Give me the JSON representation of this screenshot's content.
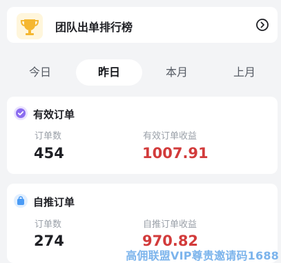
{
  "banner": {
    "title": "团队出单排行榜",
    "icon": "trophy-icon",
    "action_icon": "chevron-right-icon"
  },
  "tabs": [
    {
      "label": "今日",
      "active": false
    },
    {
      "label": "昨日",
      "active": true
    },
    {
      "label": "本月",
      "active": false
    },
    {
      "label": "上月",
      "active": false
    }
  ],
  "cards": [
    {
      "title": "有效订单",
      "icon": "check-badge-icon",
      "icon_color": "#8b6cf0",
      "count_label": "订单数",
      "count_value": "454",
      "income_label": "有效订单收益",
      "income_value": "1007.91"
    },
    {
      "title": "自推订单",
      "icon": "shopping-bag-icon",
      "icon_color": "#4a9bf5",
      "count_label": "订单数",
      "count_value": "274",
      "income_label": "自推订单收益",
      "income_value": "970.82"
    }
  ],
  "colors": {
    "accent_red": "#d23b3b",
    "trophy_gold": "#f5b731"
  },
  "watermark": "高佣联盟VIP尊贵邀请码1688"
}
